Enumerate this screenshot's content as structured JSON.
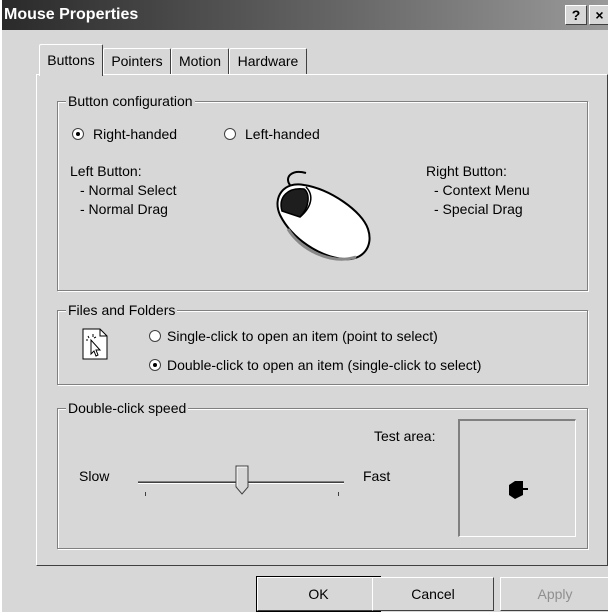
{
  "window": {
    "title": "Mouse Properties",
    "help_label": "?",
    "close_label": "×"
  },
  "tabs": [
    {
      "label": "Buttons",
      "active": true
    },
    {
      "label": "Pointers",
      "active": false
    },
    {
      "label": "Motion",
      "active": false
    },
    {
      "label": "Hardware",
      "active": false
    }
  ],
  "button_configuration": {
    "group_label": "Button configuration",
    "right_handed_label": "Right-handed",
    "left_handed_label": "Left-handed",
    "selected": "right-handed",
    "left_button": {
      "title": "Left Button:",
      "items": [
        "- Normal Select",
        "- Normal Drag"
      ]
    },
    "right_button": {
      "title": "Right Button:",
      "items": [
        "- Context Menu",
        "- Special Drag"
      ]
    }
  },
  "files_and_folders": {
    "group_label": "Files and Folders",
    "single_click_label": "Single-click to open an item (point to select)",
    "double_click_label": "Double-click to open an item (single-click to select)",
    "selected": "double-click"
  },
  "double_click_speed": {
    "group_label": "Double-click speed",
    "slow_label": "Slow",
    "fast_label": "Fast",
    "test_area_label": "Test area:",
    "slider_value": 0.5
  },
  "dialog_buttons": {
    "ok": "OK",
    "cancel": "Cancel",
    "apply": "Apply"
  }
}
